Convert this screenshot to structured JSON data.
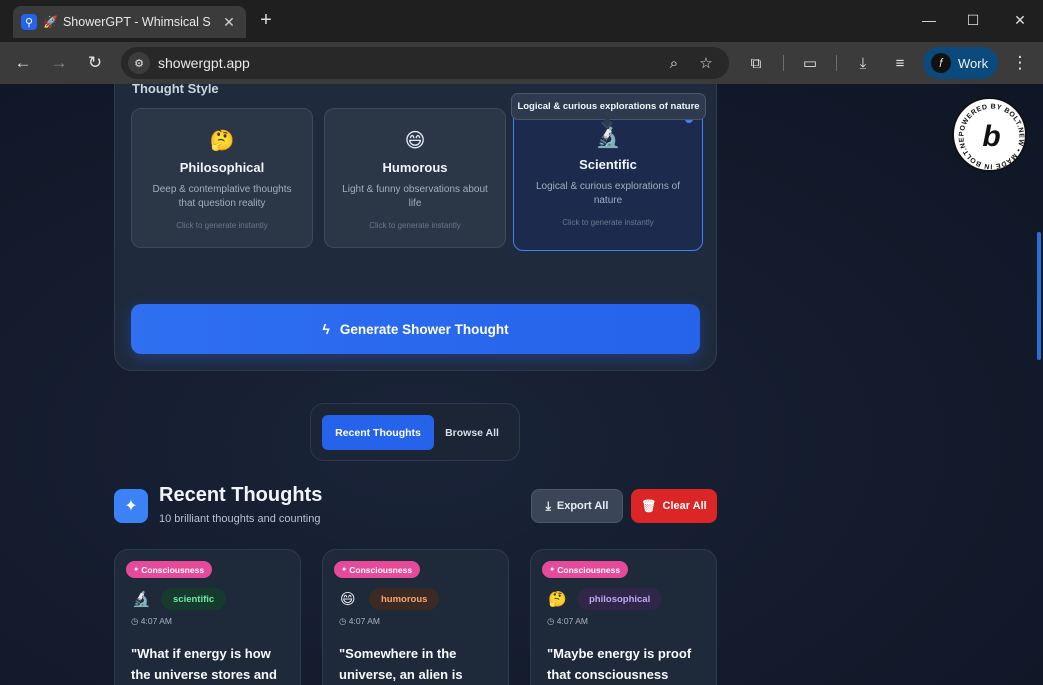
{
  "browser": {
    "tab_title": "ShowerGPT - Whimsical Shower Thoughts",
    "tab_icon": "rocket-icon",
    "new_tab_label": "+",
    "url": "showergpt.app",
    "profile_name": "Work"
  },
  "thought_style": {
    "heading": "Thought Style",
    "tooltip": "Logical & curious explorations of nature",
    "cards": [
      {
        "emoji": "🤔",
        "title": "Philosophical",
        "description": "Deep & contemplative thoughts that question reality",
        "hint": "Click to generate instantly",
        "selected": false
      },
      {
        "emoji": "😄",
        "title": "Humorous",
        "description": "Light & funny observations about life",
        "hint": "Click to generate instantly",
        "selected": false
      },
      {
        "emoji": "🔬",
        "title": "Scientific",
        "description": "Logical & curious explorations of nature",
        "hint": "Click to generate instantly",
        "selected": true
      }
    ]
  },
  "generate_button": "Generate Shower Thought",
  "view_toggle": {
    "active": "Recent Thoughts",
    "inactive": "Browse All"
  },
  "recent": {
    "title": "Recent Thoughts",
    "subtitle": "10 brilliant thoughts and counting",
    "export_label": "Export All",
    "clear_label": "Clear All",
    "thoughts": [
      {
        "category": "Consciousness",
        "emoji": "🔬",
        "style": "scientific",
        "time": "4:07 AM",
        "text": "\"What if energy is how the universe stores and"
      },
      {
        "category": "Consciousness",
        "emoji": "😄",
        "style": "humorous",
        "time": "4:07 AM",
        "text": "\"Somewhere in the universe, an alien is"
      },
      {
        "category": "Consciousness",
        "emoji": "🤔",
        "style": "philosophical",
        "time": "4:07 AM",
        "text": "\"Maybe energy is proof that consciousness"
      }
    ]
  },
  "badge": {
    "ring_text": "POWERED BY BOLT.NEW • MADE IN BOLT.NEW •",
    "letter": "b"
  },
  "colors": {
    "accent": "#2563eb",
    "danger": "#dc2626",
    "category_pink": "#e64a9a"
  }
}
